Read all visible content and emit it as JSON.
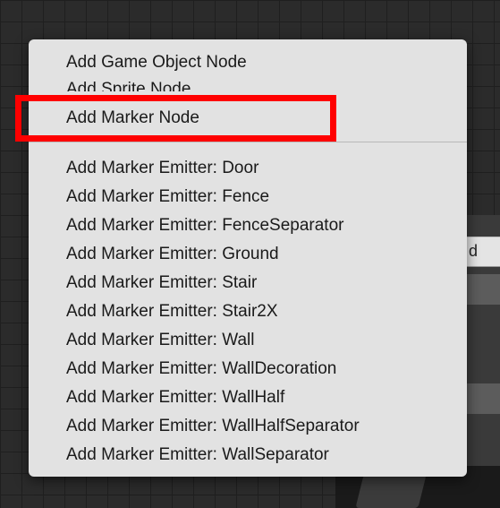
{
  "menu": {
    "items": [
      {
        "label": "Add Game Object Node"
      },
      {
        "label": "Add Sprite Node"
      },
      {
        "label": "Add Marker Node"
      }
    ],
    "emitter_items": [
      {
        "label": "Add Marker Emitter: Door"
      },
      {
        "label": "Add Marker Emitter: Fence"
      },
      {
        "label": "Add Marker Emitter: FenceSeparator"
      },
      {
        "label": "Add Marker Emitter: Ground"
      },
      {
        "label": "Add Marker Emitter: Stair"
      },
      {
        "label": "Add Marker Emitter: Stair2X"
      },
      {
        "label": "Add Marker Emitter: Wall"
      },
      {
        "label": "Add Marker Emitter: WallDecoration"
      },
      {
        "label": "Add Marker Emitter: WallHalf"
      },
      {
        "label": "Add Marker Emitter: WallHalfSeparator"
      },
      {
        "label": "Add Marker Emitter: WallSeparator"
      }
    ]
  },
  "inspector": {
    "field_text": "d"
  },
  "colors": {
    "highlight": "#ff0000",
    "menu_background": "#e2e2e2",
    "canvas_background": "#2b2b2b"
  }
}
